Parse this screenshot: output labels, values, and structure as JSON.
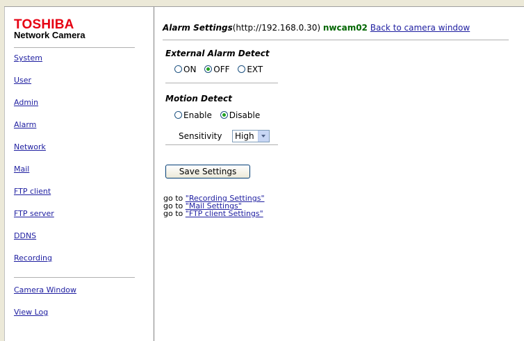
{
  "sidebar": {
    "brand": "TOSHIBA",
    "brand_sub": "Network Camera",
    "nav": [
      {
        "label": "System"
      },
      {
        "label": "User"
      },
      {
        "label": "Admin"
      },
      {
        "label": "Alarm"
      },
      {
        "label": "Network"
      },
      {
        "label": "Mail"
      },
      {
        "label": "FTP client"
      },
      {
        "label": "FTP server"
      },
      {
        "label": "DDNS"
      },
      {
        "label": "Recording"
      }
    ],
    "extra": [
      {
        "label": "Camera Window"
      },
      {
        "label": "View Log"
      }
    ]
  },
  "header": {
    "title": "Alarm Settings",
    "url": "(http://192.168.0.30)",
    "camera_name": "nwcam02",
    "back_link": "Back to camera window"
  },
  "external_alarm": {
    "heading": "External Alarm Detect",
    "options": [
      "ON",
      "OFF",
      "EXT"
    ],
    "selected": "OFF"
  },
  "motion_detect": {
    "heading": "Motion Detect",
    "options": [
      "Enable",
      "Disable"
    ],
    "selected": "Disable",
    "sensitivity_label": "Sensitivity",
    "sensitivity_value": "High"
  },
  "save_button": "Save Settings",
  "goto": {
    "prefix": "go to",
    "links": [
      "\"Recording Settings\"",
      "\"Mail Settings\"",
      "\"FTP client Settings\""
    ]
  },
  "colors": {
    "brand_red": "#e60012",
    "link_blue": "#1d1da0",
    "camera_green": "#006600"
  }
}
